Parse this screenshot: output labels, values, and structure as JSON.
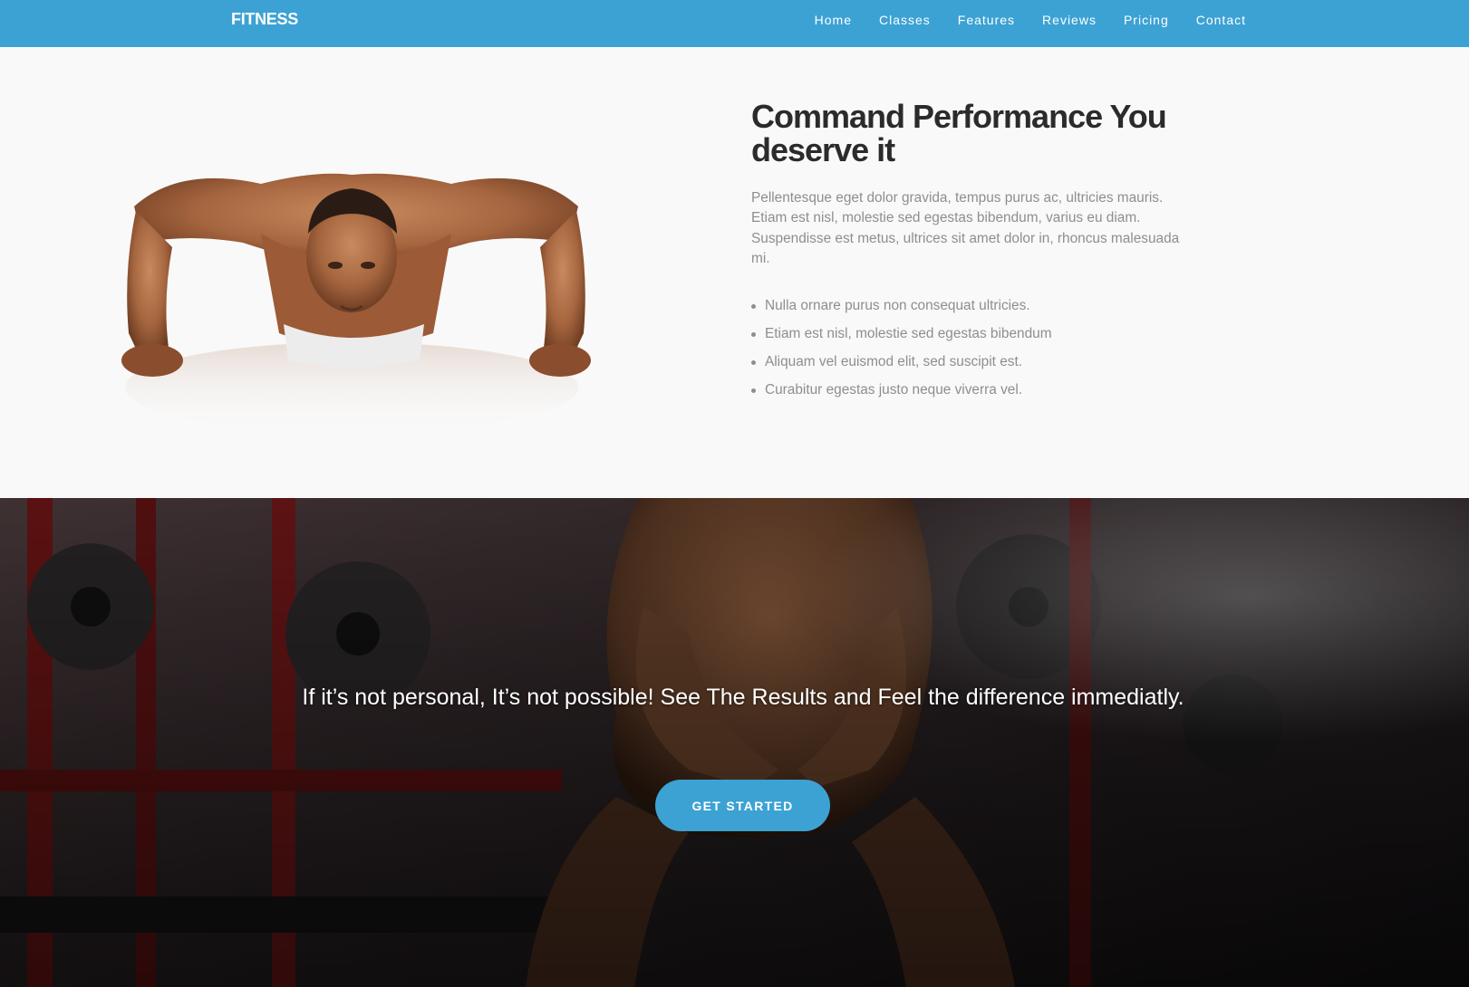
{
  "navbar": {
    "brand": "FITNESS",
    "links": [
      "Home",
      "Classes",
      "Features",
      "Reviews",
      "Pricing",
      "Contact"
    ]
  },
  "feature": {
    "title": "Command Performance You deserve it",
    "description": "Pellentesque eget dolor gravida, tempus purus ac, ultricies mauris. Etiam est nisl, molestie sed egestas bibendum, varius eu diam. Suspendisse est metus, ultrices sit amet dolor in, rhoncus malesuada mi.",
    "bullets": [
      "Nulla ornare purus non consequat ultricies.",
      "Etiam est nisl, molestie sed egestas bibendum",
      "Aliquam vel euismod elit, sed suscipit est.",
      "Curabitur egestas justo neque viverra vel."
    ]
  },
  "hero": {
    "tagline": "If it’s not personal, It’s not possible! See The Results and Feel the difference immediatly.",
    "cta_label": "GET STARTED"
  },
  "colors": {
    "brand_blue": "#3ca2d4",
    "heading": "#2b2b2b",
    "body_text": "#8e8e8e",
    "page_bg": "#f9f9f9"
  }
}
